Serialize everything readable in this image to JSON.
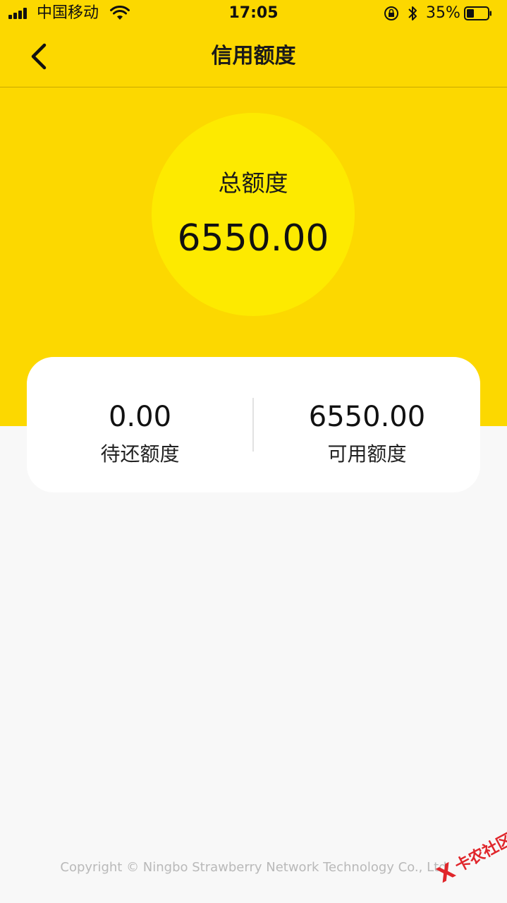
{
  "status_bar": {
    "carrier": "中国移动",
    "time": "17:05",
    "battery_percent": "35%",
    "battery_level": 0.35
  },
  "nav": {
    "title": "信用额度",
    "back_icon": "chevron-left-icon"
  },
  "total": {
    "label": "总额度",
    "value": "6550.00"
  },
  "summary": {
    "pending": {
      "value": "0.00",
      "label": "待还额度"
    },
    "available": {
      "value": "6550.00",
      "label": "可用额度"
    }
  },
  "footer": {
    "copyright": "Copyright © Ningbo Strawberry Network Technology Co., Ltd"
  },
  "watermark": {
    "mark": "X",
    "text": "卡农社区"
  },
  "colors": {
    "header_yellow": "#fcd800",
    "circle_yellow": "#fdea00",
    "page_bg": "#f8f8f8",
    "card_bg": "#ffffff",
    "watermark_red": "#e0262b"
  }
}
